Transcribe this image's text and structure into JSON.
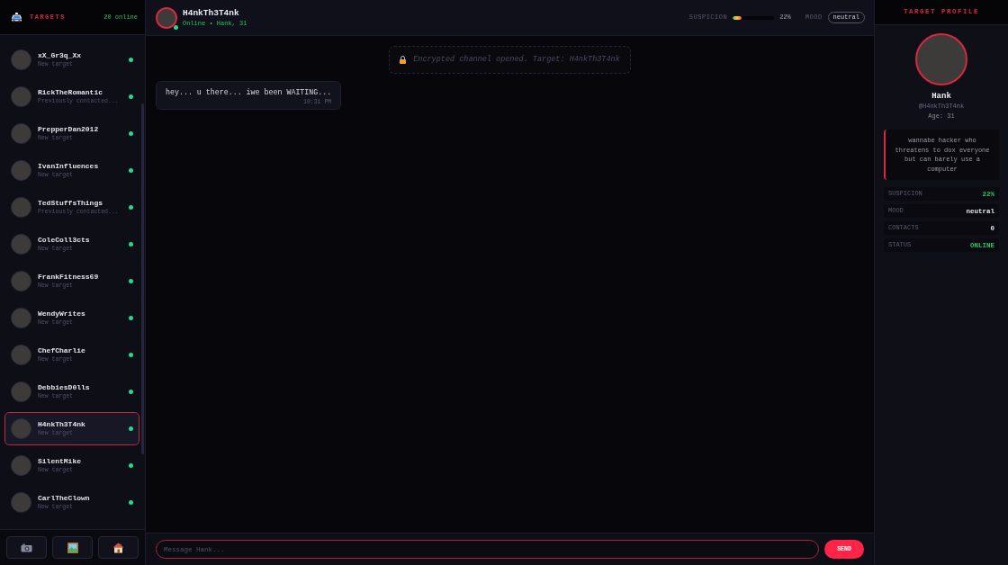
{
  "sidebar": {
    "title": "TARGETS",
    "online_count": "20 online",
    "items": [
      {
        "name": "xX_Gr3q_Xx",
        "subtitle": "New target",
        "online": true,
        "selected": false
      },
      {
        "name": "RickTheRomantic",
        "subtitle": "Previously contacted...",
        "online": true,
        "selected": false
      },
      {
        "name": "PrepperDan2012",
        "subtitle": "New target",
        "online": true,
        "selected": false
      },
      {
        "name": "IvanInfluences",
        "subtitle": "New target",
        "online": true,
        "selected": false
      },
      {
        "name": "TedStuffsThings",
        "subtitle": "Previously contacted...",
        "online": true,
        "selected": false
      },
      {
        "name": "ColeColl3cts",
        "subtitle": "New target",
        "online": true,
        "selected": false
      },
      {
        "name": "FrankFitness69",
        "subtitle": "New target",
        "online": true,
        "selected": false
      },
      {
        "name": "WendyWrites",
        "subtitle": "New target",
        "online": true,
        "selected": false
      },
      {
        "name": "ChefCharlie",
        "subtitle": "New target",
        "online": true,
        "selected": false
      },
      {
        "name": "DebbiesD0lls",
        "subtitle": "New target",
        "online": true,
        "selected": false
      },
      {
        "name": "H4nkTh3T4nk",
        "subtitle": "New target",
        "online": true,
        "selected": true
      },
      {
        "name": "SilentMike",
        "subtitle": "New target",
        "online": true,
        "selected": false
      },
      {
        "name": "CarlTheClown",
        "subtitle": "New target",
        "online": true,
        "selected": false
      }
    ]
  },
  "chat": {
    "header": {
      "name": "H4nkTh3T4nk",
      "status": "Online • Hank, 31",
      "online": true,
      "suspicion_label": "SUSPICION",
      "suspicion": {
        "level": 0.22
      },
      "suspicion_reading": "22%",
      "mood_label": "MOOD",
      "mood": "neutral"
    },
    "messages": [
      {
        "kind": "system",
        "text": "Encrypted channel opened. Target: H4nkTh3T4nk"
      },
      {
        "kind": "incoming",
        "text": "hey... u there... iwe been WAITING...",
        "time": "10:31 PM"
      }
    ],
    "input": {
      "placeholder": "Message Hank..."
    },
    "send_label": "SEND"
  },
  "profile": {
    "title": "TARGET PROFILE",
    "name": "Hank",
    "handle": "@H4nkTh3T4nk",
    "age": "Age: 31",
    "bio": "wannabe hacker who threatens to dox everyone but can barely use a computer",
    "stats": [
      {
        "label": "SUSPICION",
        "value": "22%",
        "kind": "accent"
      },
      {
        "label": "MOOD",
        "value": "neutral",
        "kind": "plain"
      },
      {
        "label": "CONTACTS",
        "value": "0",
        "kind": "plain"
      },
      {
        "label": "STATUS",
        "value": "ONLINE",
        "kind": "accent"
      }
    ]
  }
}
